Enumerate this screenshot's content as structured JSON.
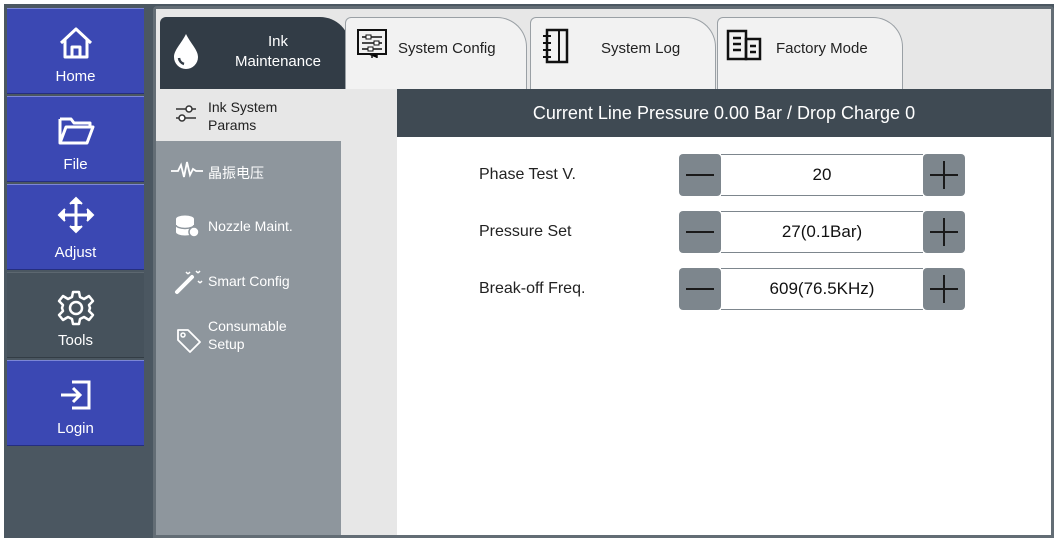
{
  "nav": {
    "items": [
      {
        "label": "Home",
        "icon": "home-icon"
      },
      {
        "label": "File",
        "icon": "folder-icon"
      },
      {
        "label": "Adjust",
        "icon": "move-arrows-icon"
      },
      {
        "label": "Tools",
        "icon": "gear-icon"
      },
      {
        "label": "Login",
        "icon": "login-icon"
      }
    ],
    "active": "Tools"
  },
  "tabs": [
    {
      "label_line1": "Ink",
      "label_line2": "Maintenance",
      "icon": "ink-drop-icon",
      "active": true
    },
    {
      "label": "System Config",
      "icon": "config-sliders-icon"
    },
    {
      "label": "System Log",
      "icon": "notebook-icon"
    },
    {
      "label": "Factory Mode",
      "icon": "factory-building-icon"
    }
  ],
  "subnav": [
    {
      "label": "Ink System",
      "label2": "Params",
      "icon": "sliders-icon",
      "active": true
    },
    {
      "label": "晶振电压",
      "icon": "waveform-icon"
    },
    {
      "label": "Nozzle Maint.",
      "icon": "nozzle-icon"
    },
    {
      "label": "Smart Config",
      "icon": "magic-wand-icon"
    },
    {
      "label": "Consumable",
      "label2": "Setup",
      "icon": "tag-icon"
    }
  ],
  "status": {
    "text": "Current Line Pressure 0.00 Bar / Drop Charge 0"
  },
  "params": [
    {
      "label": "Phase Test V.",
      "value": "20"
    },
    {
      "label": "Pressure Set",
      "value": "27(0.1Bar)"
    },
    {
      "label": "Break-off Freq.",
      "value": "609(76.5KHz)"
    }
  ],
  "colors": {
    "nav_blue": "#3b48b3",
    "nav_active": "#46525c",
    "statusbar": "#3f4a53",
    "subnav": "#8e969d"
  }
}
